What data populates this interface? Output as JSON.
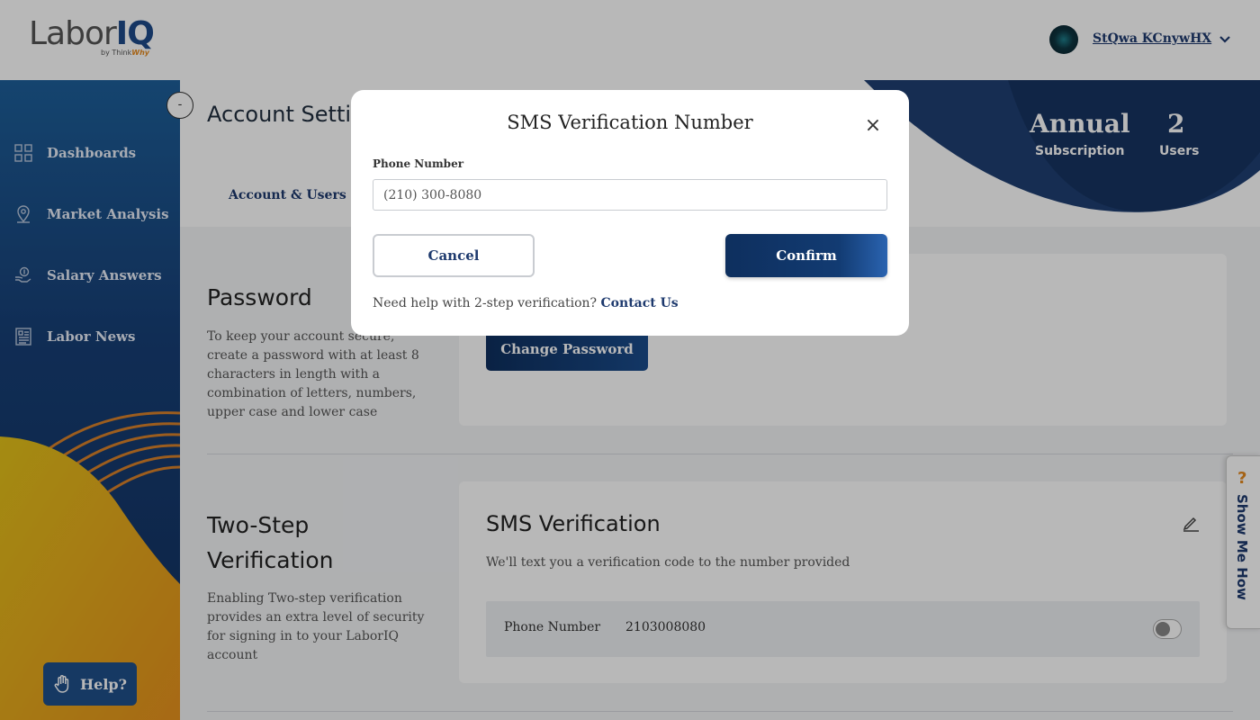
{
  "header": {
    "logo_text": "Labor",
    "logo_accent": "IQ",
    "logo_byline": "by Think",
    "logo_byline_accent": "Why",
    "user_name": "StQwa KCnywHX"
  },
  "sidebar": {
    "items": [
      {
        "label": "Dashboards",
        "icon": "grid-icon"
      },
      {
        "label": "Market Analysis",
        "icon": "map-pin-icon"
      },
      {
        "label": "Salary Answers",
        "icon": "money-hand-icon"
      },
      {
        "label": "Labor News",
        "icon": "news-icon"
      }
    ],
    "help_label": "Help?",
    "collapse_label": "-"
  },
  "main": {
    "title": "Account Settings",
    "tab_account": "Account & Users",
    "subscription": {
      "value": "Annual",
      "label": "Subscription"
    },
    "users": {
      "value": "2",
      "label": "Users"
    }
  },
  "password_section": {
    "title": "Password",
    "description": "To keep your account secure, create a password with at least 8 characters in length with a combination of letters, numbers, upper case and lower case",
    "button": "Change Password"
  },
  "two_step_section": {
    "title": "Two-Step Verification",
    "description": "Enabling Two-step verification provides an extra level of security for signing in to your LaborIQ account",
    "card_title": "SMS Verification",
    "card_desc": "We'll text you a verification code to the number provided",
    "phone_label": "Phone Number",
    "phone_value": "2103008080",
    "toggle_on": false
  },
  "show_me_how": "Show Me How",
  "modal": {
    "title": "SMS Verification Number",
    "phone_label": "Phone Number",
    "phone_value": "(210) 300-8080",
    "cancel": "Cancel",
    "confirm": "Confirm",
    "help_text": "Need help with 2-step verification?",
    "help_link": "Contact Us"
  },
  "colors": {
    "brand_navy": "#1e3a6e",
    "brand_orange": "#e58a1f",
    "sidebar_blue": "#173f76"
  }
}
